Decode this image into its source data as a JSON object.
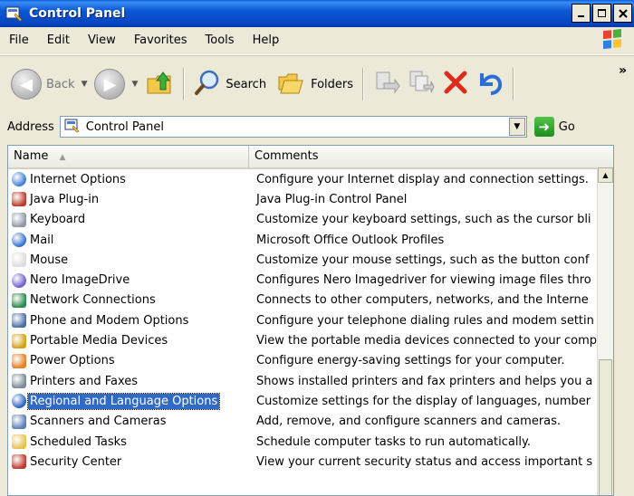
{
  "window": {
    "title": "Control Panel"
  },
  "menu": [
    "File",
    "Edit",
    "View",
    "Favorites",
    "Tools",
    "Help"
  ],
  "toolbar": {
    "back_label": "Back",
    "search_label": "Search",
    "folders_label": "Folders"
  },
  "address": {
    "label": "Address",
    "value": "Control Panel",
    "go_label": "Go"
  },
  "columns": {
    "name": "Name",
    "comments": "Comments"
  },
  "items": [
    {
      "name": "Internet Options",
      "comment": "Configure your Internet display and connection settings.",
      "icon": "globe-icon",
      "color": "#3a7bd5"
    },
    {
      "name": "Java Plug-in",
      "comment": "Java Plug-in Control Panel",
      "icon": "java-icon",
      "color": "#c0392b"
    },
    {
      "name": "Keyboard",
      "comment": "Customize your keyboard settings, such as the cursor bli",
      "icon": "keyboard-icon",
      "color": "#8f9aa6"
    },
    {
      "name": "Mail",
      "comment": "Microsoft Office Outlook Profiles",
      "icon": "mail-icon",
      "color": "#2e6fcf"
    },
    {
      "name": "Mouse",
      "comment": "Customize your mouse settings, such as the button conf",
      "icon": "mouse-icon",
      "color": "#dddddd"
    },
    {
      "name": "Nero ImageDrive",
      "comment": "Configures Nero Imagedriver for viewing image files thro",
      "icon": "disc-icon",
      "color": "#6a5acd"
    },
    {
      "name": "Network Connections",
      "comment": "Connects to other computers, networks, and the Interne",
      "icon": "network-icon",
      "color": "#2a8a4a"
    },
    {
      "name": "Phone and Modem Options",
      "comment": "Configure your telephone dialing rules and modem settin",
      "icon": "phone-icon",
      "color": "#4a6fa5"
    },
    {
      "name": "Portable Media Devices",
      "comment": "View the portable media devices connected to your comp",
      "icon": "media-device-icon",
      "color": "#d4a017"
    },
    {
      "name": "Power Options",
      "comment": "Configure energy-saving settings for your computer.",
      "icon": "power-icon",
      "color": "#e67e22"
    },
    {
      "name": "Printers and Faxes",
      "comment": "Shows installed printers and fax printers and helps you a",
      "icon": "printer-icon",
      "color": "#7a8a9a"
    },
    {
      "name": "Regional and Language Options",
      "comment": "Customize settings for the display of languages, number",
      "icon": "globe-icon",
      "color": "#1f5fbf"
    },
    {
      "name": "Scanners and Cameras",
      "comment": "Add, remove, and configure scanners and cameras.",
      "icon": "scanner-icon",
      "color": "#5b7fb8"
    },
    {
      "name": "Scheduled Tasks",
      "comment": "Schedule computer tasks to run automatically.",
      "icon": "calendar-icon",
      "color": "#e8c150"
    },
    {
      "name": "Security Center",
      "comment": "View your current security status and access important s",
      "icon": "shield-icon",
      "color": "#c0392b"
    }
  ],
  "selected_index": 11
}
